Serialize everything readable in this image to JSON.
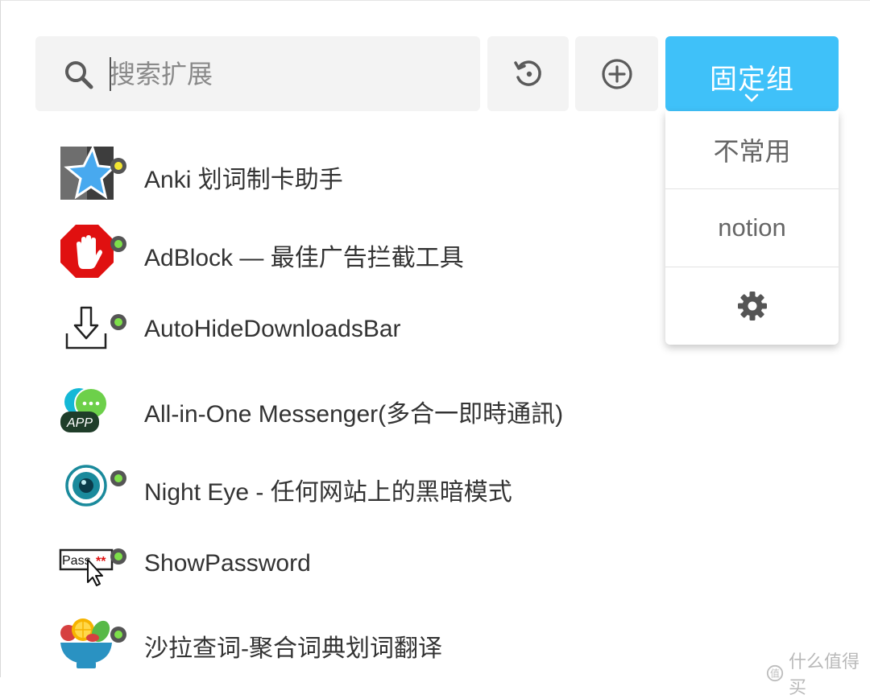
{
  "search": {
    "placeholder": "搜索扩展"
  },
  "toolbar": {
    "refresh_icon": "refresh-icon",
    "add_icon": "add-circle-icon",
    "group_label": "固定组",
    "group_icon": "chevron-down-icon",
    "accent_color": "#3fc1f9"
  },
  "dropdown": {
    "items": [
      {
        "label": "不常用"
      },
      {
        "label": "notion"
      },
      {
        "label": "",
        "icon": "gear-icon"
      }
    ]
  },
  "extensions": [
    {
      "name": "Anki 划词制卡助手",
      "icon": "anki-star-icon",
      "dot_color": "#f2e532"
    },
    {
      "name": "AdBlock — 最佳广告拦截工具",
      "icon": "adblock-hand-icon",
      "dot_color": "#7ee04a"
    },
    {
      "name": "AutoHideDownloadsBar",
      "icon": "download-tray-icon",
      "dot_color": "#7ee04a"
    },
    {
      "name": "All-in-One Messenger(多合一即時通訊)",
      "icon": "messenger-bubbles-icon",
      "dot_color": "#7ee04a",
      "badge": "APP"
    },
    {
      "name": "Night Eye - 任何网站上的黑暗模式",
      "icon": "eye-icon",
      "dot_color": "#7ee04a"
    },
    {
      "name": "ShowPassword",
      "icon": "password-cursor-icon",
      "dot_color": "#7ee04a",
      "badge": "Pass"
    },
    {
      "name": "沙拉查词-聚合词典划词翻译",
      "icon": "salad-bowl-icon",
      "dot_color": "#7ee04a"
    }
  ],
  "watermark": {
    "text": "什么值得买"
  }
}
